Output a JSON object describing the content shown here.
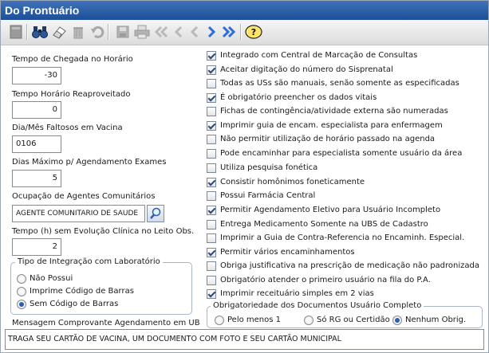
{
  "window": {
    "title": "Do Prontuário"
  },
  "toolbar": {
    "icons": [
      "new-icon",
      "binoculars-icon",
      "eraser-icon",
      "trash-icon",
      "undo-icon",
      "save-icon",
      "print-icon",
      "first-icon",
      "previous-icon",
      "next-icon",
      "last-icon",
      "help-icon"
    ],
    "help_glyph": "?"
  },
  "fields": {
    "arrival_time": {
      "label": "Tempo de Chegada no Horário",
      "value": "-30"
    },
    "reused_time": {
      "label": "Tempo Horário Reaproveitado",
      "value": "0"
    },
    "vaccine_missing": {
      "label": "Dia/Mês Faltosos em Vacina",
      "value": "0106"
    },
    "max_days": {
      "label": "Dias Máximo p/ Agendamento Exames",
      "value": "5"
    },
    "occupation": {
      "label": "Ocupação de Agentes Comunitários",
      "value": "AGENTE COMUNITARIO DE SAUDE"
    },
    "no_evolution": {
      "label": "Tempo (h) sem Evolução Clínica no Leito Obs.",
      "value": "2"
    }
  },
  "lab_integration": {
    "title": "Tipo de Integração com Laboratório",
    "options": [
      {
        "label": "Não Possui",
        "selected": false
      },
      {
        "label": "Imprime Código de Barras",
        "selected": false
      },
      {
        "label": "Sem Código de Barras",
        "selected": true
      }
    ]
  },
  "checkboxes": [
    {
      "label": "Integrado com Central de Marcação de Consultas",
      "checked": true
    },
    {
      "label": "Aceitar digitação do número do Sisprenatal",
      "checked": true
    },
    {
      "label": "Todas as USs são manuais, senão somente as especificadas",
      "checked": false
    },
    {
      "label": "É obrigatório preencher os dados vitais",
      "checked": true
    },
    {
      "label": "Fichas de contingência/atividade externa são numeradas",
      "checked": false
    },
    {
      "label": "Imprimir guia de encam. especialista para enfermagem",
      "checked": true
    },
    {
      "label": "Não permitir utilização de horário passado na agenda",
      "checked": false
    },
    {
      "label": "Pode encaminhar para especialista somente usuário da área",
      "checked": false
    },
    {
      "label": "Utiliza pesquisa fonética",
      "checked": false
    },
    {
      "label": "Consistir homônimos foneticamente",
      "checked": true
    },
    {
      "label": "Possui Farmácia Central",
      "checked": false
    },
    {
      "label": "Permitir Agendamento Eletivo para Usuário Incompleto",
      "checked": true
    },
    {
      "label": "Entrega Medicamento Somente na UBS de Cadastro",
      "checked": false
    },
    {
      "label": "Imprimir a Guia de Contra-Referencia no Encaminh. Especial.",
      "checked": false
    },
    {
      "label": "Permitir vários encaminhamentos",
      "checked": true
    },
    {
      "label": "Obriga justificativa na prescrição de medicação não padronizada",
      "checked": false
    },
    {
      "label": "Obrigatório atender o primeiro usuário na fila do P.A.",
      "checked": false
    },
    {
      "label": "Imprimir receituário simples em 2 vias",
      "checked": true
    }
  ],
  "doc_requirement": {
    "title": "Obrigatoriedade dos Documentos Usuário Completo",
    "options": [
      {
        "label": "Pelo menos 1",
        "selected": false
      },
      {
        "label": "Só RG ou Certidão",
        "selected": false
      },
      {
        "label": "Nenhum Obrig.",
        "selected": true
      }
    ]
  },
  "message": {
    "label": "Mensagem Comprovante Agendamento em UB",
    "value": "TRAGA SEU CARTÃO DE VACINA, UM DOCUMENTO COM FOTO E SEU CARTÃO MUNICIPAL"
  }
}
